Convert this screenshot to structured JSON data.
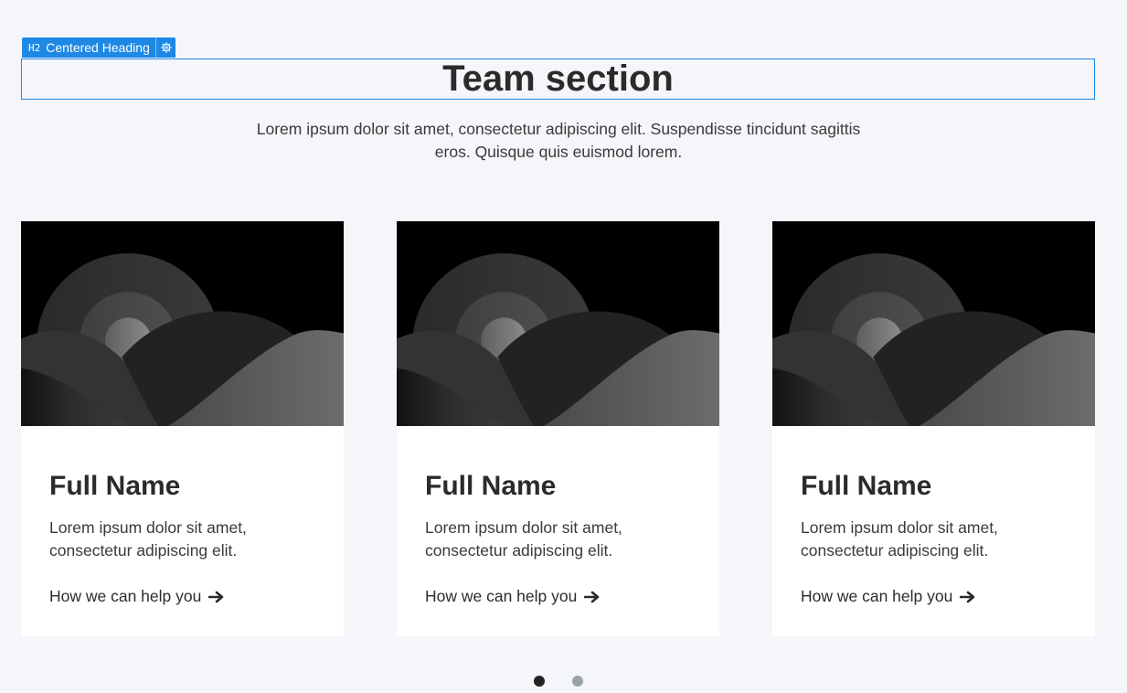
{
  "editor": {
    "tag": "H2",
    "label": "Centered Heading",
    "icon": "gear-icon",
    "accent_color": "#1e88e5"
  },
  "section": {
    "title": "Team section",
    "intro": "Lorem ipsum dolor sit amet, consectetur adipiscing elit. Suspendisse tincidunt sagittis eros. Quisque quis euismod lorem."
  },
  "cards": [
    {
      "image": "landscape-placeholder-image",
      "name": "Full Name",
      "description": "Lorem ipsum dolor sit amet, consectetur adipiscing elit.",
      "link": "How we can help you",
      "link_icon": "arrow-right-icon"
    },
    {
      "image": "landscape-placeholder-image",
      "name": "Full Name",
      "description": "Lorem ipsum dolor sit amet, consectetur adipiscing elit.",
      "link": "How we can help you",
      "link_icon": "arrow-right-icon"
    },
    {
      "image": "landscape-placeholder-image",
      "name": "Full Name",
      "description": "Lorem ipsum dolor sit amet, consectetur adipiscing elit.",
      "link": "How we can help you",
      "link_icon": "arrow-right-icon"
    }
  ],
  "pagination": {
    "total_pages": 2,
    "current_page": 1
  },
  "colors": {
    "background": "#f5f6fa",
    "card_background": "#ffffff",
    "text": "#2b2b2b",
    "dot_active": "#222222",
    "dot_inactive": "#9aa3a9"
  }
}
